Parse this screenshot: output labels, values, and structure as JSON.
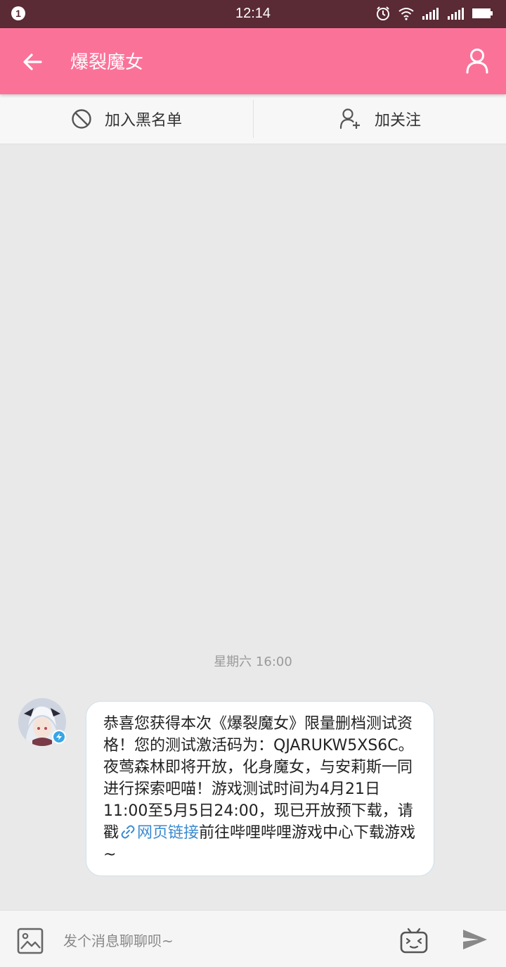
{
  "status_bar": {
    "notification_count": "1",
    "time": "12:14"
  },
  "header": {
    "title": "爆裂魔女"
  },
  "actions": {
    "block_label": "加入黑名单",
    "follow_label": "加关注"
  },
  "chat": {
    "timestamp": "星期六 16:00",
    "message": {
      "text_before": "恭喜您获得本次《爆裂魔女》限量删档测试资格！您的测试激活码为：QJARUKW5XS6C。夜莺森林即将开放，化身魔女，与安莉斯一同进行探索吧喵！游戏测试时间为4月21日11:00至5月5日24:00，现已开放预下载，请戳",
      "link_text": "网页链接",
      "text_after": "前往哔哩哔哩游戏中心下载游戏~"
    }
  },
  "input": {
    "placeholder": "发个消息聊聊呗~"
  },
  "icons": {
    "back": "arrow-left-icon",
    "profile": "user-icon",
    "block": "ban-icon",
    "follow": "user-plus-icon",
    "link": "link-icon",
    "image": "image-icon",
    "emoji": "bilibili-tv-emoji-icon",
    "send": "send-icon"
  },
  "colors": {
    "accent": "#fb7299",
    "status_bar": "#5a2a35",
    "link": "#3a8bd0"
  }
}
